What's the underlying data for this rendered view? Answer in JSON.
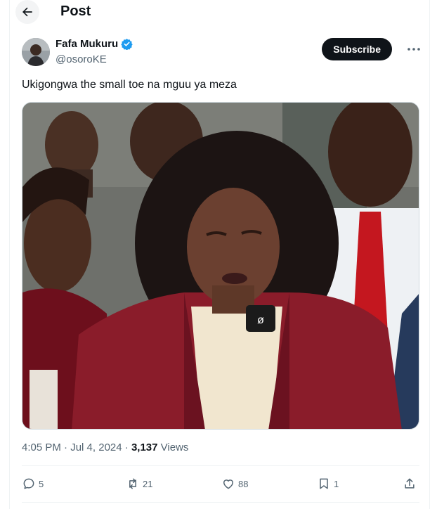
{
  "header": {
    "title": "Post"
  },
  "author": {
    "name": "Fafa Mukuru",
    "handle": "@osoroKE",
    "verified": true
  },
  "subscribe_label": "Subscribe",
  "tweet": {
    "text": "Ukigongwa the small toe na mguu ya meza"
  },
  "meta": {
    "time": "4:05 PM",
    "separator": " · ",
    "date": "Jul 4, 2024",
    "views_count": "3,137",
    "views_label": " Views"
  },
  "actions": {
    "replies": "5",
    "reposts": "21",
    "likes": "88",
    "bookmarks": "1"
  },
  "colors": {
    "accent": "#1d9bf0",
    "text": "#0f1419",
    "secondary": "#536471",
    "button_bg": "#0f1419",
    "gown": "#8a1c2a"
  },
  "icons": [
    "back-arrow-icon",
    "verified-badge-icon",
    "more-icon",
    "reply-icon",
    "repost-icon",
    "like-icon",
    "bookmark-icon",
    "share-icon"
  ]
}
